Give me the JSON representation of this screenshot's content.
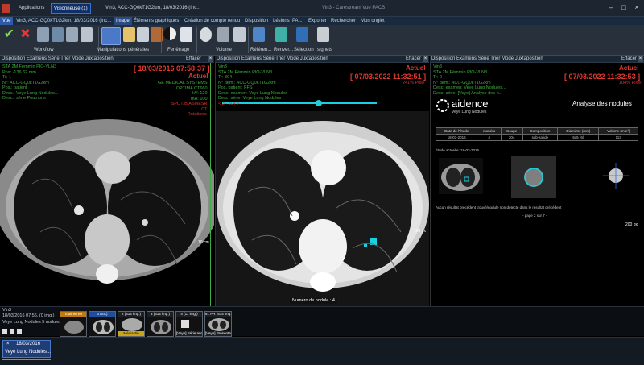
{
  "titlebar": {
    "tabs": [
      {
        "label": "Applications"
      },
      {
        "label": "Visionneuse (1)"
      },
      {
        "label": "Vin3, ACC-GQ0kT1G2km, 18/03/2016 (Inc..."
      }
    ],
    "center_title": "Vin3 - Carestream Vue PACS"
  },
  "menubar": {
    "items": [
      "Vue",
      "Vin3, ACC-GQ0kT1G2km, 18/03/2016 (Inc...",
      "Image",
      "Éléments graphiques",
      "Création de compte rendu",
      "Disposition",
      "Lésions",
      "PA...",
      "Exporter",
      "Rechercher",
      "Mon onglet"
    ],
    "active": "Image"
  },
  "ribbon": {
    "groups": [
      "Workflow",
      "Manipulations générales",
      "Fenêtrage",
      "Volume",
      "Référen...",
      "Renver...",
      "Sélection",
      "signets"
    ]
  },
  "panels": [
    {
      "label": "Disposition   Examens   Série   Trier   Mode Juxtaposition",
      "close": "Effacer"
    },
    {
      "label": "Disposition   Examens   Série   Trier   Mode Juxtaposition",
      "close": "Effacer"
    },
    {
      "label": "Disposition   Examens   Série   Trier   Mode Juxtaposition",
      "close": "Effacer"
    }
  ],
  "left_view": {
    "lines": [
      "STA 2M Fémmin PIO-VLN3",
      "Pos: -136.62 mm",
      "Tr: 1",
      "N°: ACC-GQ0kT1G2km",
      "Pos.: patient",
      "Desc.: Veye Lung Nodules...",
      "Desc.: série Poumons"
    ],
    "date": "[ 18/03/2016 07:58:37 ]",
    "status": "Actuel",
    "right_lines": [
      "GE MEDICAL SYSTEMS",
      "OPTIMA CT660",
      "kV: 120",
      "mA: 100",
      "SPOT/B/ASMESR",
      "CT",
      "Rotations:"
    ],
    "scale": "10 cm"
  },
  "center_view": {
    "lines": [
      "Vin3",
      "STA 2M Fémmin PIO-VLN3",
      "Tr: 304",
      "N° dem.: ACC-GQ0kT1G2km",
      "Pos. patient: FFS",
      "Desc. examen: Veye Lung Nodules",
      "Desc. série: Veye Lung Nodules",
      "< 3 - 304 >"
    ],
    "date": "[ 07/03/2022 11:32:51 ]",
    "status": "Actuel",
    "zoom": "241% Pixel",
    "nodule_label": "Numéro de nodule : 4",
    "scale": "100 px"
  },
  "right_view": {
    "lines": [
      "Vin3",
      "STA 2M Fémmin PIO-VLN3",
      "Tr: 2",
      "N° dem.: ACC-GQ0kT1G2km",
      "Desc. examen: Veye Lung Nodules...",
      "Desc. série: [Veye] Analyse des n..."
    ],
    "date": "[ 07/03/2022 11:32:53 ]",
    "status": "Actuel",
    "zoom": "104% Pixel",
    "brand": "aidence",
    "brand_sub": "Veye Lung Nodules",
    "report_title": "Analyse des nodules",
    "table_headers": [
      "Date de l'étude",
      "numéro",
      "Coupe",
      "Composition",
      "Diamètre (mm)",
      "Volume (mm³)"
    ],
    "table_rows": [
      [
        "18-03-2016",
        "4",
        "304",
        "sub-solide",
        "6x5 (6)",
        "113"
      ]
    ],
    "study_note": "Étude actuelle: 18-03-2016",
    "no_prev_note": "Aucun résultat précédent trouvé/nodule non détecté dans le résultat précédent",
    "page_note": "- page 2 sur 7 -",
    "scale": "200 px"
  },
  "status_area": {
    "title": "Vin3",
    "subtitle": "18/03/2016 07:56, (0 img.)",
    "series_label": "Veye Lung Nodules 5 nodules (4 ...)"
  },
  "thumbnails": [
    {
      "top": "Total en en",
      "bottom": ""
    },
    {
      "top": "3 (SC)",
      "bottom": ""
    },
    {
      "top": "2 (514 img.)",
      "bottom": "Médiastin"
    },
    {
      "top": "3 (514 img.)",
      "bottom": ""
    },
    {
      "top": "4 (11 img.)",
      "bottom": "[Veye] Série ann"
    },
    {
      "top": "5 (7 img.)",
      "bottom": "[Veye] Analyse"
    },
    {
      "top": "6 : PR (514 img.)",
      "bottom": "[Veye] Présentat"
    }
  ],
  "study_tab": {
    "date": "18/03/2016",
    "label": "Veye Lung Nodules..."
  },
  "colors": {
    "accent": "#2e5aa8",
    "overlay_green": "#3fae3f",
    "overlay_red": "#e0342c",
    "cyan": "#1ad0e0"
  }
}
